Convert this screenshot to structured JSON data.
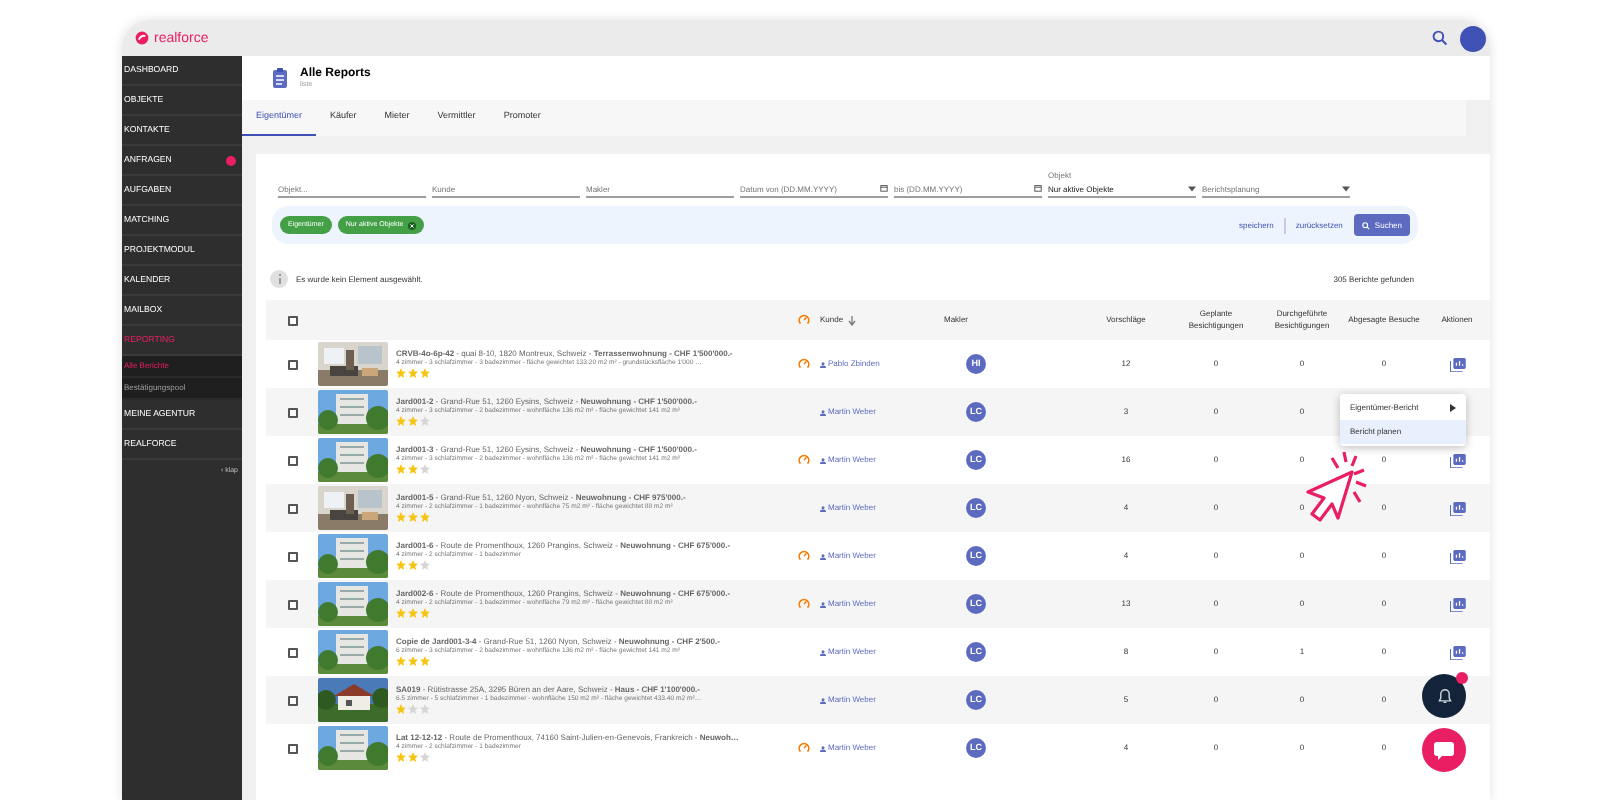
{
  "app": {
    "logo": "realforce"
  },
  "sidebar": {
    "items": [
      {
        "label": "DASHBOARD",
        "selected": false,
        "badge": false
      },
      {
        "label": "OBJEKTE",
        "selected": false,
        "badge": false
      },
      {
        "label": "KONTAKTE",
        "selected": false,
        "badge": false
      },
      {
        "label": "ANFRAGEN",
        "selected": false,
        "badge": true
      },
      {
        "label": "AUFGABEN",
        "selected": false,
        "badge": false
      },
      {
        "label": "MATCHING",
        "selected": false,
        "badge": false
      },
      {
        "label": "PROJEKTMODUL",
        "selected": false,
        "badge": false
      },
      {
        "label": "KALENDER",
        "selected": false,
        "badge": false
      },
      {
        "label": "MAILBOX",
        "selected": false,
        "badge": false
      },
      {
        "label": "REPORTING",
        "selected": true,
        "badge": false,
        "children": [
          {
            "label": "Alle Berichte",
            "selected": true
          },
          {
            "label": "Bestätigungspool",
            "selected": false
          }
        ]
      },
      {
        "label": "MEINE AGENTUR",
        "selected": false,
        "badge": false
      },
      {
        "label": "REALFORCE",
        "selected": false,
        "badge": false
      }
    ],
    "collapse": "‹ klap"
  },
  "page": {
    "title": "Alle Reports",
    "subtitle": "liste"
  },
  "tabs": [
    {
      "label": "Eigentümer",
      "selected": true
    },
    {
      "label": "Käufer",
      "selected": false
    },
    {
      "label": "Mieter",
      "selected": false
    },
    {
      "label": "Vermittler",
      "selected": false
    },
    {
      "label": "Promoter",
      "selected": false
    }
  ],
  "filters": [
    {
      "kind": "text",
      "placeholder": "Objekt..."
    },
    {
      "kind": "text",
      "placeholder": "Kunde"
    },
    {
      "kind": "text",
      "placeholder": "Makler"
    },
    {
      "kind": "date",
      "placeholder": "Datum von (DD.MM.YYYY)"
    },
    {
      "kind": "date",
      "placeholder": "bis (DD.MM.YYYY)"
    },
    {
      "kind": "select",
      "label": "Objekt",
      "value": "Nur aktive Objekte"
    },
    {
      "kind": "select",
      "placeholder": "Berichtsplanung"
    }
  ],
  "chips": [
    {
      "label": "Eigentümer",
      "removable": false
    },
    {
      "label": "Nur aktive Objekte",
      "removable": true
    }
  ],
  "actions": {
    "save": "speichern",
    "reset": "zurücksetzen",
    "search": "Suchen"
  },
  "selection_info": "Es wurde kein Element ausgewählt.",
  "result_count": "305 Berichte gefunden",
  "table": {
    "all_checked": false,
    "columns": [
      {
        "label": "Kunde",
        "sorted": true
      },
      {
        "label": "Makler",
        "sorted": false
      },
      {
        "label": "Vorschläge",
        "sorted": false
      },
      {
        "label": "Geplante Besichtigungen",
        "sorted": false
      },
      {
        "label": "Durchgeführte Besichtigungen",
        "sorted": false
      },
      {
        "label": "Abgesagte Besuche",
        "sorted": false
      },
      {
        "label": "Aktionen",
        "sorted": false
      }
    ],
    "rows": [
      {
        "checked": false,
        "title": "**CRVB-4o-6p-42** - quai 8-10, 1820 Montreux, Schweiz - **Terrassenwohnung - CHF 1'500'000.-**",
        "details": "4 zimmer - 3 schlafzimmer - 3 badezimmer - fläche gewichtet 133.20 m2 m² - grundstücksfläche 1'000 …",
        "stars": 3,
        "flagged": true,
        "kunde": "Pablo Zbinden",
        "makler": "HI",
        "vorschlaege": "12",
        "geplant": "0",
        "durchgefuehrt": "0",
        "abgesagt": "0",
        "report_button": true
      },
      {
        "checked": false,
        "title": "**Jard001-2** - Grand-Rue 51, 1260 Eysins, Schweiz - **Neuwohnung - CHF 1'500'000.-**",
        "details": "4 zimmer - 3 schlafzimmer - 2 badezimmer - wohnfläche 136 m2 m² - fläche gewichtet 141 m2 m²",
        "stars": 2,
        "flagged": false,
        "kunde": "Martin Weber",
        "makler": "LC",
        "vorschlaege": "3",
        "geplant": "0",
        "durchgefuehrt": "0",
        "report_button": false
      },
      {
        "checked": false,
        "title": "**Jard001-3** - Grand-Rue 51, 1260 Eysins, Schweiz - **Neuwohnung - CHF 1'500'000.-**",
        "details": "4 zimmer - 3 schlafzimmer - 2 badezimmer - wohnfläche 136 m2 m² - fläche gewichtet 141 m2 m²",
        "stars": 2,
        "flagged": true,
        "kunde": "Martin Weber",
        "makler": "LC",
        "vorschlaege": "16",
        "geplant": "0",
        "durchgefuehrt": "0",
        "abgesagt": "0",
        "report_button": true
      },
      {
        "checked": false,
        "title": "**Jard001-5** - Grand-Rue 51, 1260 Nyon, Schweiz - **Neuwohnung - CHF 975'000.-**",
        "details": "4 zimmer - 2 schlafzimmer - 1 badezimmer - wohnfläche 75 m2 m² - fläche gewichtet 88 m2 m²",
        "stars": 3,
        "flagged": false,
        "kunde": "Martin Weber",
        "makler": "LC",
        "vorschlaege": "4",
        "geplant": "0",
        "durchgefuehrt": "0",
        "abgesagt": "0",
        "report_button": true
      },
      {
        "checked": false,
        "title": "**Jard001-6** - Route de Promenthoux, 1260 Prangins, Schweiz - **Neuwohnung - CHF 675'000.-**",
        "details": "4 zimmer - 2 schlafzimmer - 1 badezimmer",
        "stars": 2,
        "flagged": true,
        "kunde": "Martin Weber",
        "makler": "LC",
        "vorschlaege": "4",
        "geplant": "0",
        "durchgefuehrt": "0",
        "abgesagt": "0",
        "report_button": true
      },
      {
        "checked": false,
        "title": "**Jard002-6** - Route de Promenthoux, 1260 Prangins, Schweiz - **Neuwohnung - CHF 675'000.-**",
        "details": "4 zimmer - 2 schlafzimmer - 1 badezimmer - wohnfläche 79 m2 m² - fläche gewichtet 88 m2 m²",
        "stars": 3,
        "flagged": true,
        "kunde": "Martin Weber",
        "makler": "LC",
        "vorschlaege": "13",
        "geplant": "0",
        "durchgefuehrt": "0",
        "abgesagt": "0",
        "report_button": true
      },
      {
        "checked": false,
        "title": "**Copie de Jard001-3-4** - Grand-Rue 51, 1260 Nyon, Schweiz - **Neuwohnung - CHF 2'500.-**",
        "details": "6 zimmer - 3 schlafzimmer - 2 badezimmer - wohnfläche 136 m2 m² - fläche gewichtet 141 m2 m²",
        "stars": 3,
        "flagged": false,
        "kunde": "Martin Weber",
        "makler": "LC",
        "vorschlaege": "8",
        "geplant": "0",
        "durchgefuehrt": "1",
        "abgesagt": "0",
        "report_button": true
      },
      {
        "checked": false,
        "title": "**SA019** - Rütistrasse 25A, 3295 Büren an der Aare, Schweiz - **Haus - CHF 1'100'000.-**",
        "details": "6.5 zimmer - 5 schlafzimmer - 1 badezimmer - wohnfläche 150 m2 m² - fläche gewichtet 433.40 m2 m²…",
        "stars": 1,
        "flagged": false,
        "kunde": "Martin Weber",
        "makler": "LC",
        "vorschlaege": "5",
        "geplant": "0",
        "durchgefuehrt": "0",
        "abgesagt": "0",
        "report_button": false
      },
      {
        "checked": false,
        "title": "**Lat 12-12-12** - Route de Promenthoux, 74160 Saint-Julien-en-Genevois, Frankreich - **Neuwoh…**",
        "details": "4 zimmer - 2 schlafzimmer - 1 badezimmer",
        "stars": 2,
        "flagged": true,
        "kunde": "Martin Weber",
        "makler": "LC",
        "vorschlaege": "4",
        "geplant": "0",
        "durchgefuehrt": "0",
        "abgesagt": "0",
        "report_button": false
      }
    ]
  },
  "context_menu": {
    "items": [
      {
        "label": "Eigentümer-Bericht",
        "submenu": true,
        "highlighted": false
      },
      {
        "label": "Bericht planen",
        "submenu": false,
        "highlighted": true
      }
    ]
  },
  "notifications": {
    "unread": true
  }
}
